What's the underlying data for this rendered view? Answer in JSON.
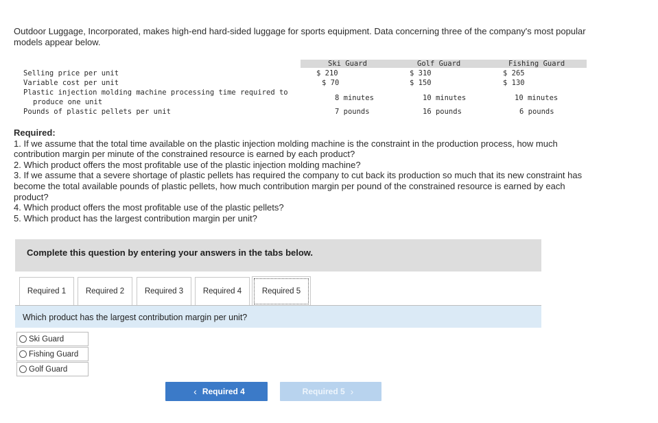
{
  "intro": "Outdoor Luggage, Incorporated, makes high-end hard-sided luggage for sports equipment. Data concerning three of the company's most popular models appear below.",
  "table": {
    "columns": [
      "Ski Guard",
      "Golf Guard",
      "Fishing Guard"
    ],
    "rows": [
      {
        "label": "Selling price per unit",
        "values": [
          "$ 210",
          "$ 310",
          "$ 265"
        ]
      },
      {
        "label": "Variable cost per unit",
        "values": [
          "$ 70",
          "$ 150",
          "$ 130"
        ]
      },
      {
        "label": "Plastic injection molding machine processing time required to",
        "label2": "produce one unit",
        "values": [
          "8 minutes",
          "10 minutes",
          "10 minutes"
        ]
      },
      {
        "label": "Pounds of plastic pellets per unit",
        "values": [
          "7 pounds",
          "16 pounds",
          "6 pounds"
        ]
      }
    ]
  },
  "required": {
    "title": "Required:",
    "items": [
      "1. If we assume that the total time available on the plastic injection molding machine is the constraint in the production process, how much contribution margin per minute of the constrained resource is earned by each product?",
      "2. Which product offers the most profitable use of the plastic injection molding machine?",
      "3. If we assume that a severe shortage of plastic pellets has required the company to cut back its production so much that its new constraint has become the total available pounds of plastic pellets, how much contribution margin per pound of the constrained resource is earned by each product?",
      "4. Which product offers the most profitable use of the plastic pellets?",
      "5. Which product has the largest contribution margin per unit?"
    ]
  },
  "panel_text": "Complete this question by entering your answers in the tabs below.",
  "tabs": [
    "Required 1",
    "Required 2",
    "Required 3",
    "Required 4",
    "Required 5"
  ],
  "active_tab": "Required 5",
  "question": "Which product has the largest contribution margin per unit?",
  "options": [
    "Ski Guard",
    "Fishing Guard",
    "Golf Guard"
  ],
  "nav": {
    "prev": "Required 4",
    "next": "Required 5",
    "prev_icon": "chevron-left-icon",
    "next_icon": "chevron-right-icon"
  },
  "colors": {
    "accent": "#3b7ac8",
    "disabled": "#b8d3ee",
    "question_bg": "#dbeaf6"
  }
}
